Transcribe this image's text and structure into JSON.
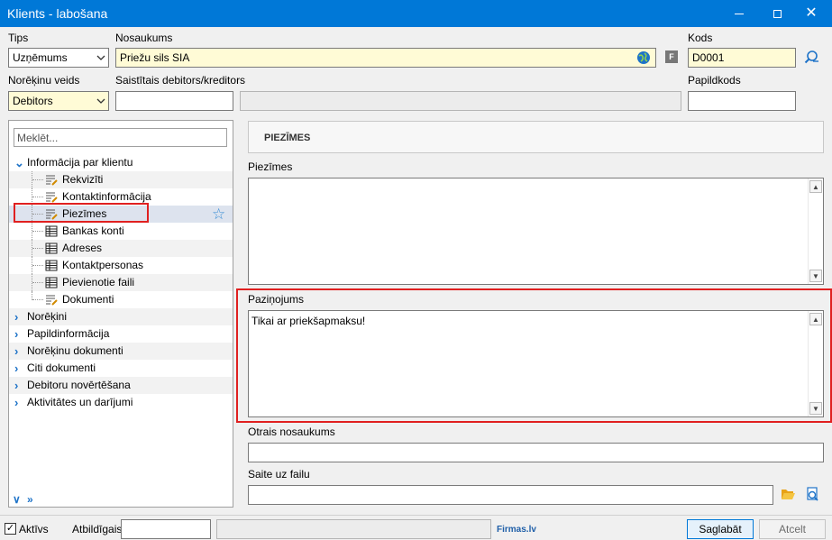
{
  "window": {
    "title": "Klients - labošana",
    "minimize": "—",
    "close": "✕"
  },
  "top": {
    "tips_label": "Tips",
    "tips_value": "Uzņēmums",
    "nosaukums_label": "Nosaukums",
    "nosaukums_value": "Priežu sils SIA",
    "f_badge": "F",
    "kods_label": "Kods",
    "kods_value": "D0001",
    "norekinu_veids_label": "Norēķinu veids",
    "norekinu_veids_value": "Debitors",
    "saistitais_label": "Saistītais debitors/kreditors",
    "saistitais_value": "",
    "papildkods_label": "Papildkods",
    "papildkods_value": ""
  },
  "tree": {
    "search_placeholder": "Meklēt...",
    "group_label": "Informācija par klientu",
    "children": [
      {
        "label": "Rekvizīti",
        "icon": "form-edit-icon"
      },
      {
        "label": "Kontaktinformācija",
        "icon": "form-edit-icon"
      },
      {
        "label": "Piezīmes",
        "icon": "form-edit-icon"
      },
      {
        "label": "Bankas konti",
        "icon": "grid-list-icon"
      },
      {
        "label": "Adreses",
        "icon": "grid-list-icon"
      },
      {
        "label": "Kontaktpersonas",
        "icon": "grid-list-icon"
      },
      {
        "label": "Pievienotie faili",
        "icon": "grid-list-icon"
      },
      {
        "label": "Dokumenti",
        "icon": "form-edit-icon"
      }
    ],
    "collapsed": [
      "Norēķini",
      "Papildinformācija",
      "Norēķinu dokumenti",
      "Citi dokumenti",
      "Debitoru novērtēšana",
      "Aktivitātes un darījumi"
    ],
    "selected_index": 2
  },
  "section": {
    "header": "PIEZĪMES",
    "piezimes_label": "Piezīmes",
    "piezimes_value": "",
    "pazinojums_label": "Paziņojums",
    "pazinojums_value": "Tikai ar priekšapmaksu!",
    "otrais_label": "Otrais nosaukums",
    "otrais_value": "",
    "saite_label": "Saite uz failu",
    "saite_value": ""
  },
  "footer": {
    "aktivs_label": "Aktīvs",
    "aktivs_checked": true,
    "atbildigais_label": "Atbildīgais",
    "atbildigais_value": "",
    "brand": "Firmas.lv",
    "save_label": "Saglabāt",
    "cancel_label": "Atcelt"
  },
  "colors": {
    "titlebar": "#0078d7",
    "highlight_box": "#e02020",
    "required_field": "#fffbd6",
    "accent": "#1e73c8"
  }
}
